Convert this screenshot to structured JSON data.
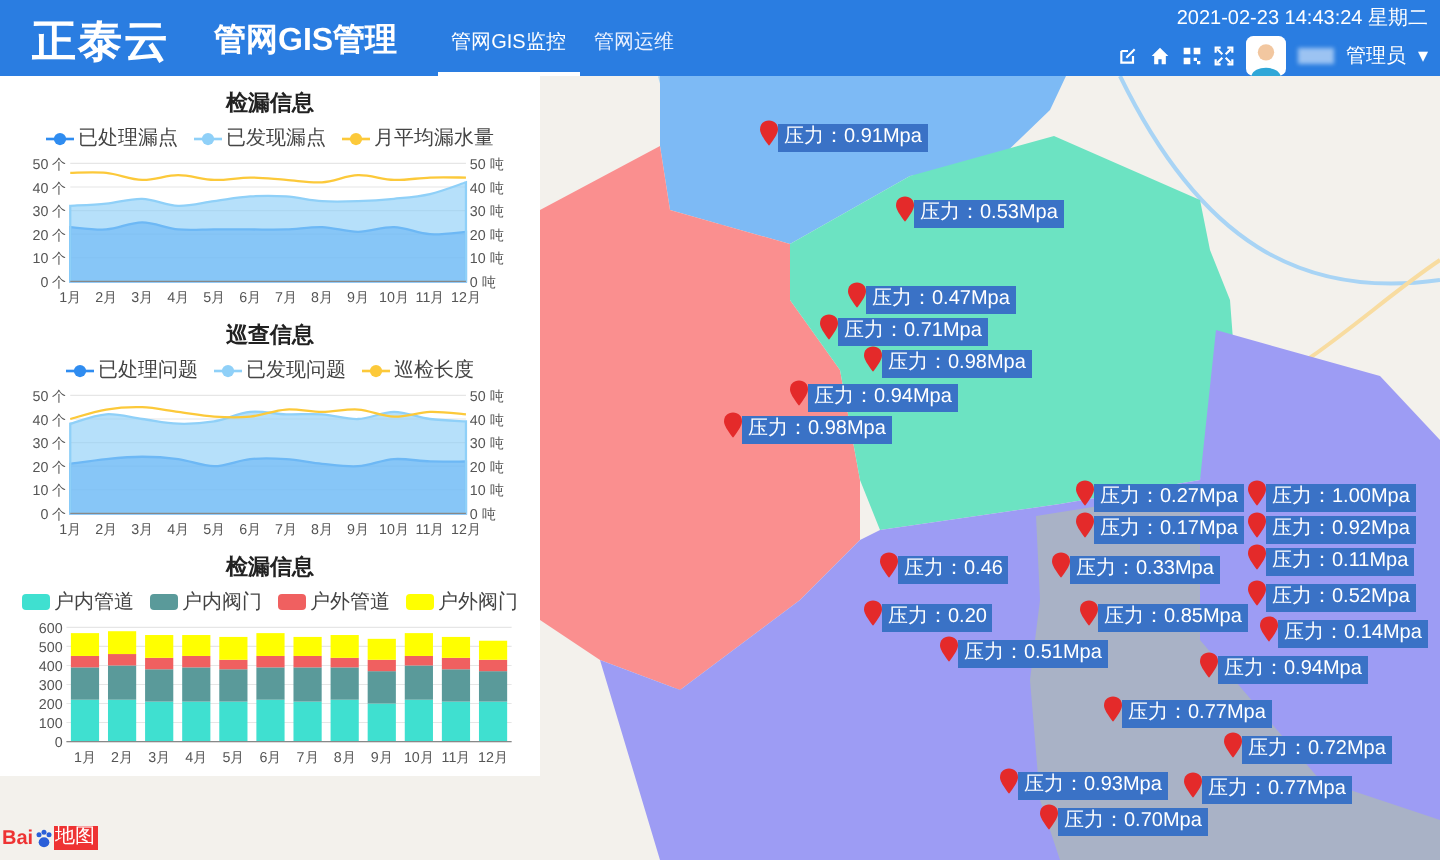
{
  "header": {
    "logo": "正泰云",
    "title": "管网GIS管理",
    "tabs": [
      {
        "label": "管网GIS监控",
        "selected": true
      },
      {
        "label": "管网运维",
        "selected": false
      }
    ],
    "datetime": "2021-02-23 14:43:24 星期二",
    "user": "管理员",
    "user_menu_caret": "▾"
  },
  "panels": [
    {
      "title": "检漏信息",
      "chart_data": {
        "type": "area",
        "grid": true,
        "categories": [
          "1月",
          "2月",
          "3月",
          "4月",
          "5月",
          "6月",
          "7月",
          "8月",
          "9月",
          "10月",
          "11月",
          "12月"
        ],
        "ylim": [
          0,
          50
        ],
        "yticks": [
          {
            "value": 0,
            "label": "0 个"
          },
          {
            "value": 10,
            "label": "10 个"
          },
          {
            "value": 20,
            "label": "20 个"
          },
          {
            "value": 30,
            "label": "30 个"
          },
          {
            "value": 40,
            "label": "40 个"
          },
          {
            "value": 50,
            "label": "50 个"
          }
        ],
        "y2lim": [
          0,
          50
        ],
        "y2ticks": [
          {
            "value": 0,
            "label": "0 吨"
          },
          {
            "value": 10,
            "label": "10 吨"
          },
          {
            "value": 20,
            "label": "20 吨"
          },
          {
            "value": 30,
            "label": "30 吨"
          },
          {
            "value": 40,
            "label": "40 吨"
          },
          {
            "value": 50,
            "label": "50 吨"
          }
        ],
        "series": [
          {
            "name": "已处理漏点",
            "color": "#2f8cf0",
            "type": "area",
            "values": [
              23,
              22,
              25,
              22,
              22,
              22,
              22,
              23,
              21,
              23,
              20,
              21
            ]
          },
          {
            "name": "已发现漏点",
            "color": "#8fd0f8",
            "type": "area",
            "values": [
              32,
              33,
              35,
              32,
              34,
              36,
              36,
              34,
              34,
              35,
              37,
              42
            ]
          },
          {
            "name": "月平均漏水量",
            "color": "#fcc93a",
            "type": "line",
            "values": [
              46,
              46,
              43,
              45,
              43,
              44,
              43,
              42,
              45,
              43,
              44,
              44
            ]
          }
        ]
      }
    },
    {
      "title": "巡查信息",
      "chart_data": {
        "type": "area",
        "grid": true,
        "categories": [
          "1月",
          "2月",
          "3月",
          "4月",
          "5月",
          "6月",
          "7月",
          "8月",
          "9月",
          "10月",
          "11月",
          "12月"
        ],
        "ylim": [
          0,
          50
        ],
        "yticks": [
          {
            "value": 0,
            "label": "0 个"
          },
          {
            "value": 10,
            "label": "10 个"
          },
          {
            "value": 20,
            "label": "20 个"
          },
          {
            "value": 30,
            "label": "30 个"
          },
          {
            "value": 40,
            "label": "40 个"
          },
          {
            "value": 50,
            "label": "50 个"
          }
        ],
        "y2lim": [
          0,
          50
        ],
        "y2ticks": [
          {
            "value": 0,
            "label": "0 吨"
          },
          {
            "value": 10,
            "label": "10 吨"
          },
          {
            "value": 20,
            "label": "20 吨"
          },
          {
            "value": 30,
            "label": "30 吨"
          },
          {
            "value": 40,
            "label": "40 吨"
          },
          {
            "value": 50,
            "label": "50 吨"
          }
        ],
        "series": [
          {
            "name": "已处理问题",
            "color": "#2f8cf0",
            "type": "area",
            "values": [
              21,
              23,
              24,
              23,
              20,
              23,
              23,
              21,
              20,
              23,
              22,
              22
            ]
          },
          {
            "name": "已发现问题",
            "color": "#8fd0f8",
            "type": "area",
            "values": [
              38,
              42,
              40,
              38,
              39,
              43,
              42,
              42,
              40,
              43,
              40,
              39
            ]
          },
          {
            "name": "巡检长度",
            "color": "#fcc93a",
            "type": "line",
            "values": [
              40,
              44,
              45,
              43,
              41,
              41,
              44,
              43,
              44,
              41,
              43,
              42
            ]
          }
        ]
      }
    },
    {
      "title": "检漏信息",
      "chart_data": {
        "type": "bar",
        "stacked": true,
        "grid": true,
        "categories": [
          "1月",
          "2月",
          "3月",
          "4月",
          "5月",
          "6月",
          "7月",
          "8月",
          "9月",
          "10月",
          "11月",
          "12月"
        ],
        "ylim": [
          0,
          600
        ],
        "yticks": [
          0,
          100,
          200,
          300,
          400,
          500,
          600
        ],
        "series": [
          {
            "name": "户内管道",
            "color": "#3fe0d0",
            "values": [
              220,
              220,
              210,
              210,
              210,
              220,
              210,
              220,
              200,
              220,
              210,
              210
            ]
          },
          {
            "name": "户内阀门",
            "color": "#5a9a9a",
            "values": [
              170,
              180,
              170,
              180,
              170,
              170,
              180,
              170,
              170,
              180,
              170,
              160
            ]
          },
          {
            "name": "户外管道",
            "color": "#f06060",
            "values": [
              60,
              60,
              60,
              60,
              50,
              60,
              60,
              50,
              60,
              50,
              60,
              60
            ]
          },
          {
            "name": "户外阀门",
            "color": "#ffff00",
            "values": [
              120,
              120,
              120,
              110,
              120,
              120,
              100,
              120,
              110,
              120,
              110,
              100
            ]
          }
        ]
      }
    }
  ],
  "markers": [
    "压力：0.91Mpa",
    "压力：0.53Mpa",
    "压力：0.47Mpa",
    "压力：0.71Mpa",
    "压力：0.98Mpa",
    "压力：0.94Mpa",
    "压力：0.98Mpa",
    "压力：0.27Mpa",
    "压力：1.00Mpa",
    "压力：0.17Mpa",
    "压力：0.92Mpa",
    "压力：0.46",
    "压力：0.33Mpa",
    "压力：0.11Mpa",
    "压力：0.52Mpa",
    "压力：0.20",
    "压力：0.51Mpa",
    "压力：0.85Mpa",
    "压力：0.14Mpa",
    "压力：0.94Mpa",
    "压力：0.77Mpa",
    "压力：0.72Mpa",
    "压力：0.93Mpa",
    "压力：0.77Mpa",
    "压力：0.70Mpa"
  ],
  "map_logo": {
    "prefix": "Bai",
    "suffix": "地图"
  }
}
